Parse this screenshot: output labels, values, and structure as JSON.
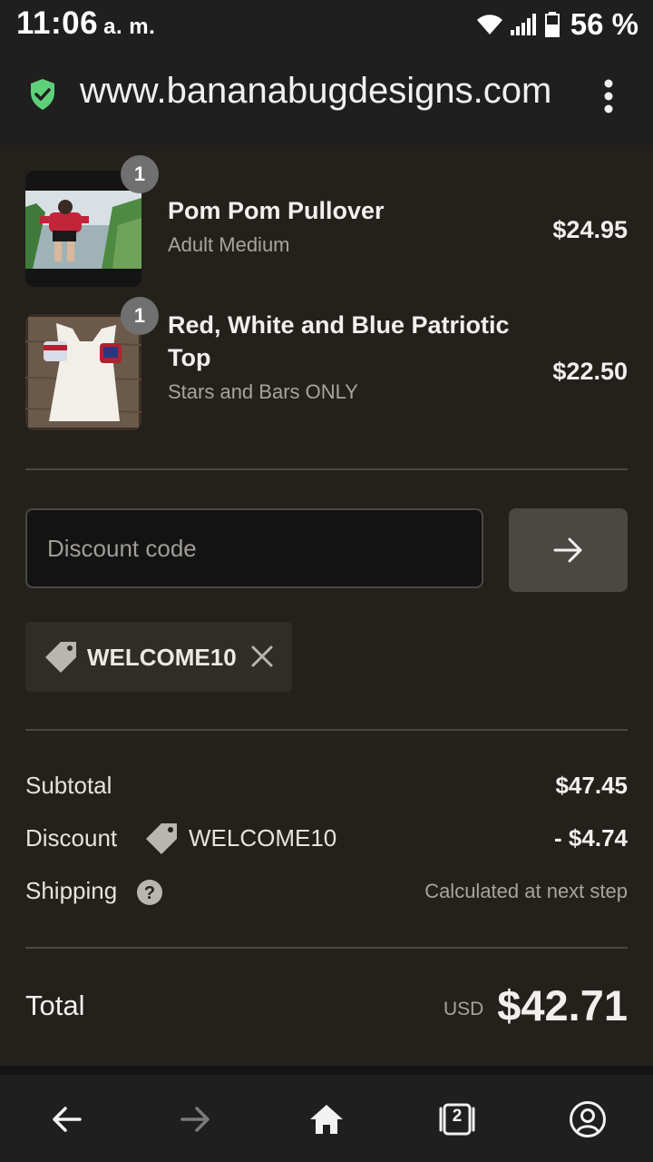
{
  "status_bar": {
    "time": "11:06",
    "ampm": "a. m.",
    "battery": "56 %"
  },
  "browser": {
    "url": "www.bananabugdesigns.com"
  },
  "cart": {
    "items": [
      {
        "quantity": "1",
        "name": "Pom Pom Pullover",
        "variant": "Adult Medium",
        "price": "$24.95"
      },
      {
        "quantity": "1",
        "name": "Red, White and Blue Patriotic Top",
        "variant": "Stars and Bars ONLY",
        "price": "$22.50"
      }
    ]
  },
  "discount": {
    "placeholder": "Discount code",
    "applied_code": "WELCOME10"
  },
  "summary": {
    "subtotal_label": "Subtotal",
    "subtotal_value": "$47.45",
    "discount_label": "Discount",
    "discount_code": "WELCOME10",
    "discount_value": "- $4.74",
    "shipping_label": "Shipping",
    "shipping_value": "Calculated at next step",
    "total_label": "Total",
    "currency": "USD",
    "total_value": "$42.71"
  },
  "nav": {
    "tab_count": "2"
  },
  "colors": {
    "background": "#24211d",
    "secure_green": "#5fd07a",
    "chrome": "#1f1f1f"
  }
}
